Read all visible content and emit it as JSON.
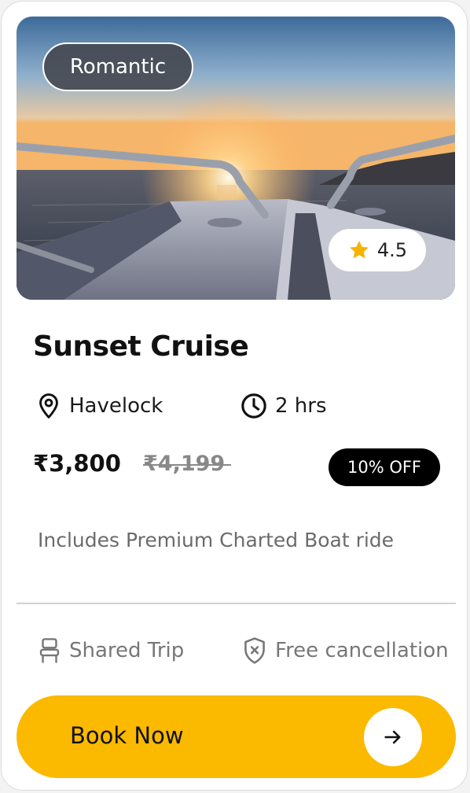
{
  "card": {
    "tag": "Romantic",
    "rating": "4.5",
    "title": "Sunset Cruise",
    "location": "Havelock",
    "duration": "2 hrs",
    "price": "₹3,800",
    "original_price": "₹4,199",
    "discount": "10% OFF",
    "includes": "Includes Premium Charted Boat ride",
    "features": {
      "trip_type": "Shared Trip",
      "cancellation": "Free cancellation"
    },
    "cta_label": "Book Now"
  },
  "icons": {
    "rating": "star-icon",
    "location": "location-pin-icon",
    "duration": "clock-icon",
    "trip_type": "seat-icon",
    "cancellation": "shield-x-icon",
    "cta": "arrow-right-icon"
  },
  "colors": {
    "accent": "#fbb900",
    "star": "#f5b400",
    "discount_bg": "#000000",
    "tag_bg": "#464a52"
  }
}
